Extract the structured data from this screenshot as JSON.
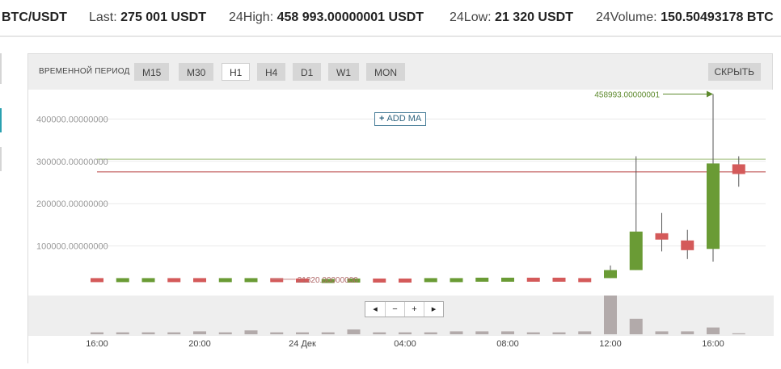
{
  "ticker": {
    "pair": "BTC/USDT",
    "last_label": "Last:",
    "last_value": "275 001 USDT",
    "high_label": "24High:",
    "high_value": "458 993.00000001 USDT",
    "low_label": "24Low:",
    "low_value": "21 320 USDT",
    "volume_label": "24Volume:",
    "volume_value": "150.50493178 BTC"
  },
  "toolbar": {
    "period_label": "ВРЕМЕННОЙ ПЕРИОД",
    "periods": [
      "M15",
      "M30",
      "H1",
      "H4",
      "D1",
      "W1",
      "MON"
    ],
    "active_period": "H1",
    "hide_label": "СКРЫТЬ"
  },
  "ma_button": {
    "plus": "+",
    "label": "ADD MA"
  },
  "zoom": {
    "scroll_left": "◂",
    "zoom_out": "−",
    "zoom_in": "+",
    "scroll_right": "▸"
  },
  "colors": {
    "up": "#6a9b35",
    "down": "#d45a5a",
    "volume": "#b2aaaa",
    "last_line": "#b84040",
    "ref_line": "#9dbb78",
    "annotation": "#5e8a2e"
  },
  "chart_data": {
    "type": "candlestick",
    "y_ticks": [
      "400000.00000000",
      "300000.00000000",
      "200000.00000000",
      "100000.00000000"
    ],
    "y_tick_values": [
      400000,
      300000,
      200000,
      100000
    ],
    "ylim": [
      0,
      450000
    ],
    "x_labels": [
      "16:00",
      "20:00",
      "24 Дек",
      "04:00",
      "08:00",
      "12:00",
      "16:00"
    ],
    "x_label_index": [
      0,
      4,
      8,
      12,
      16,
      20,
      24
    ],
    "last_price": 275001,
    "ref_price": 305000,
    "max_annotation": {
      "text": "458993.00000001",
      "value": 458993,
      "index": 24
    },
    "min_annotation": {
      "text": "21320.00000000",
      "value": 21320,
      "index": 9
    },
    "candles": [
      {
        "o": 24000,
        "h": 24000,
        "l": 24000,
        "c": 23000
      },
      {
        "o": 23000,
        "h": 23000,
        "l": 23000,
        "c": 24000
      },
      {
        "o": 23000,
        "h": 23000,
        "l": 23000,
        "c": 24000
      },
      {
        "o": 24000,
        "h": 24000,
        "l": 24000,
        "c": 23000
      },
      {
        "o": 24000,
        "h": 24000,
        "l": 24000,
        "c": 23000
      },
      {
        "o": 23000,
        "h": 23000,
        "l": 23000,
        "c": 24000
      },
      {
        "o": 23000,
        "h": 23000,
        "l": 23000,
        "c": 24000
      },
      {
        "o": 24000,
        "h": 24000,
        "l": 24000,
        "c": 23000
      },
      {
        "o": 23000,
        "h": 23000,
        "l": 23000,
        "c": 22000
      },
      {
        "o": 21320,
        "h": 21320,
        "l": 21320,
        "c": 22000
      },
      {
        "o": 22000,
        "h": 24000,
        "l": 22000,
        "c": 23000
      },
      {
        "o": 23000,
        "h": 23000,
        "l": 23000,
        "c": 22000
      },
      {
        "o": 23000,
        "h": 23000,
        "l": 23000,
        "c": 22000
      },
      {
        "o": 23000,
        "h": 23000,
        "l": 23000,
        "c": 24000
      },
      {
        "o": 23000,
        "h": 23000,
        "l": 23000,
        "c": 24000
      },
      {
        "o": 24000,
        "h": 24000,
        "l": 24000,
        "c": 25000
      },
      {
        "o": 24000,
        "h": 24000,
        "l": 24000,
        "c": 25000
      },
      {
        "o": 25000,
        "h": 25000,
        "l": 25000,
        "c": 24000
      },
      {
        "o": 25000,
        "h": 25000,
        "l": 25000,
        "c": 24000
      },
      {
        "o": 24000,
        "h": 24000,
        "l": 24000,
        "c": 23000
      },
      {
        "o": 24000,
        "h": 54000,
        "l": 24000,
        "c": 43000
      },
      {
        "o": 43000,
        "h": 312000,
        "l": 43000,
        "c": 134000
      },
      {
        "o": 130000,
        "h": 178000,
        "l": 87000,
        "c": 115000
      },
      {
        "o": 113000,
        "h": 138000,
        "l": 69000,
        "c": 90000
      },
      {
        "o": 93000,
        "h": 458993,
        "l": 63000,
        "c": 295000
      },
      {
        "o": 293000,
        "h": 312000,
        "l": 240000,
        "c": 270000
      }
    ],
    "volume": [
      2,
      2,
      2,
      2,
      3,
      2,
      4,
      2,
      2,
      2,
      5,
      2,
      2,
      2,
      3,
      3,
      3,
      2,
      2,
      3,
      40,
      16,
      3,
      3,
      7,
      1
    ]
  }
}
